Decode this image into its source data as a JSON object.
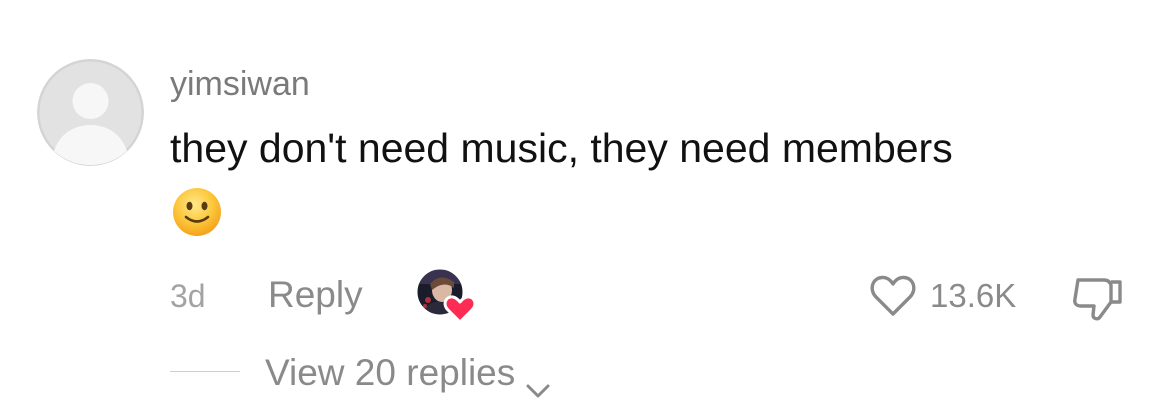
{
  "comment": {
    "username": "yimsiwan",
    "text": "they don't need music, they need members",
    "emoji": "🙂",
    "timestamp": "3d",
    "reply_label": "Reply",
    "like_count": "13.6K",
    "view_replies_label": "View 20 replies"
  },
  "icons": {
    "avatar": "default-avatar-icon",
    "creator_like": "creator-liked-heart-icon",
    "like": "heart-outline-icon",
    "dislike": "thumbs-down-icon",
    "expand": "chevron-down-icon"
  },
  "colors": {
    "heart_accent": "#fe2c55",
    "secondary_text": "#8a8a8a",
    "primary_text": "#111111"
  }
}
